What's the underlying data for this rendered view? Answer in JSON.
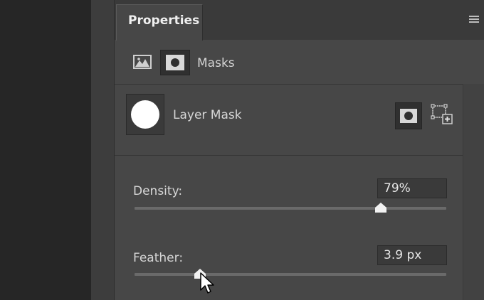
{
  "panel": {
    "title": "Properties"
  },
  "masks": {
    "label": "Masks"
  },
  "layer_mask": {
    "label": "Layer Mask"
  },
  "density": {
    "label": "Density:",
    "value": "79%",
    "percent": 79
  },
  "feather": {
    "label": "Feather:",
    "value": "3.9 px",
    "slider_fraction": 0.21
  },
  "icons": {
    "panel_menu": "hamburger-menu-icon",
    "pixel_mask": "pixel-mask-icon",
    "vector_mask": "vector-mask-icon",
    "apply_mask": "apply-mask-icon",
    "select_mask": "select-mask-icon",
    "cursor": "mouse-pointer-icon"
  }
}
